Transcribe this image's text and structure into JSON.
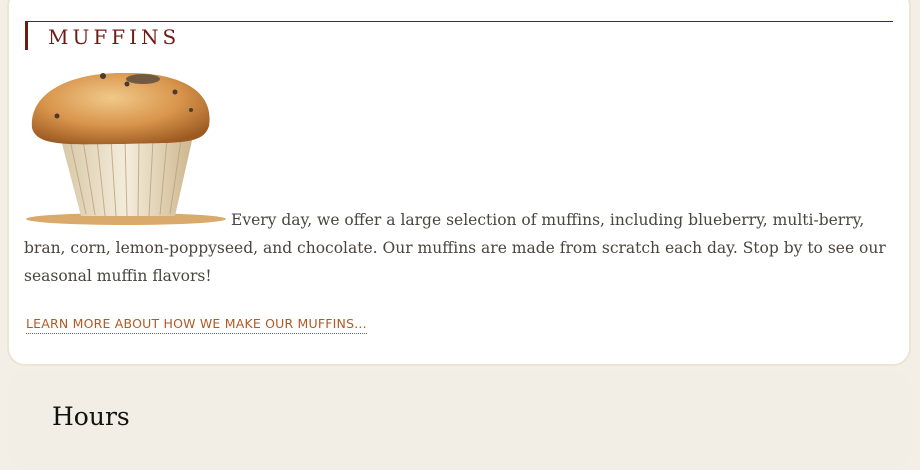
{
  "section": {
    "title": "MUFFINS",
    "image_icon": "muffin-photo",
    "description": "Every day, we offer a large selection of muffins, including blueberry, multi-berry, bran, corn, lemon-poppyseed, and chocolate. Our muffins are made from scratch each day. Stop by to see our seasonal muffin flavors!",
    "link_label": "LEARN MORE ABOUT HOW WE MAKE OUR MUFFINS..."
  },
  "hours": {
    "title": "Hours"
  },
  "colors": {
    "accent": "#6e1c14",
    "link": "#b05a24",
    "text": "#4a4540",
    "panel": "#f2eee5"
  }
}
